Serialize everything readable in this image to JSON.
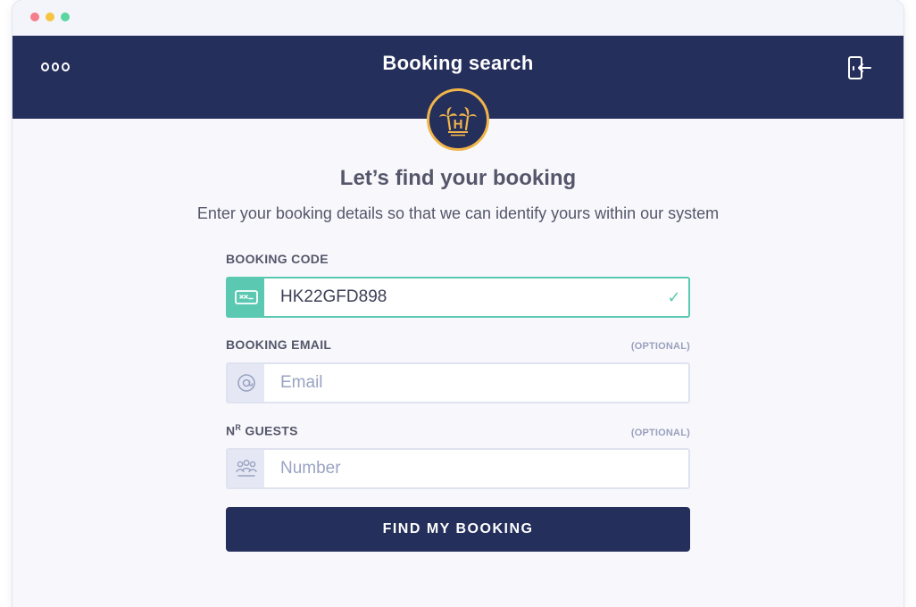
{
  "colors": {
    "header_bg": "#252f5c",
    "accent_teal": "#5bc9b2",
    "logo_ring": "#f1b54a",
    "dot_red": "#f47f8b",
    "dot_yellow": "#f5c542",
    "dot_green": "#5cd6a0"
  },
  "header": {
    "title": "Booking search",
    "menu_icon": "more-dots-icon",
    "exit_icon": "exit-door-icon"
  },
  "logo": {
    "icon": "palm-trees-logo-icon",
    "letter": "H"
  },
  "intro": {
    "heading": "Let’s find your booking",
    "subheading": "Enter your booking details so that we can identify yours within our system"
  },
  "form": {
    "booking_code": {
      "label": "BOOKING CODE",
      "value": "HK22GFD898",
      "icon": "ticket-icon",
      "valid_icon": "checkmark-icon"
    },
    "booking_email": {
      "label": "BOOKING EMAIL",
      "optional": "(OPTIONAL)",
      "placeholder": "Email",
      "icon": "at-sign-icon"
    },
    "guests": {
      "label_main": "N",
      "label_sup": "R",
      "label_rest": " GUESTS",
      "optional": "(OPTIONAL)",
      "placeholder": "Number",
      "icon": "people-group-icon"
    },
    "submit_label": "FIND MY BOOKING"
  }
}
